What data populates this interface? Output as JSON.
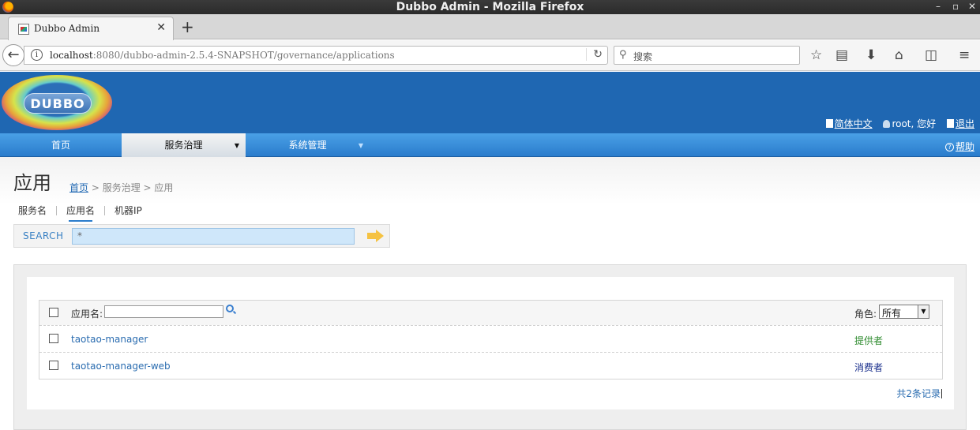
{
  "window": {
    "title": "Dubbo Admin - Mozilla Firefox"
  },
  "tab": {
    "label": "Dubbo Admin"
  },
  "navbar": {
    "url_host": "localhost",
    "url_path": ":8080/dubbo-admin-2.5.4-SNAPSHOT/governance/applications",
    "search_placeholder": "搜索"
  },
  "header": {
    "logo_text": "DUBBO",
    "language_link": "简体中文",
    "user_greeting": "root, 您好",
    "logout_link": "退出"
  },
  "menu": {
    "items": [
      {
        "label": "首页"
      },
      {
        "label": "服务治理"
      },
      {
        "label": "系统管理"
      }
    ],
    "help": "帮助"
  },
  "page": {
    "title": "应用",
    "breadcrumb": {
      "home": "首页",
      "rest": " > 服务治理 > 应用"
    },
    "subtabs": [
      {
        "label": "服务名"
      },
      {
        "label": "应用名"
      },
      {
        "label": "机器IP"
      }
    ],
    "search": {
      "label": "SEARCH",
      "value": "*"
    }
  },
  "table": {
    "app_name_label": "应用名:",
    "role_label": "角色:",
    "role_selected": "所有",
    "rows": [
      {
        "name": "taotao-manager",
        "role": "提供者",
        "role_color": "#2e8b2e"
      },
      {
        "name": "taotao-manager-web",
        "role": "消费者",
        "role_color": "#1a2f8c"
      }
    ],
    "total": "共2条记录"
  }
}
